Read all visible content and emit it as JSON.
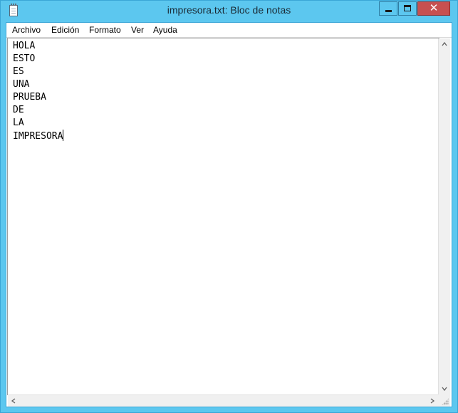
{
  "window": {
    "title": "impresora.txt: Bloc de notas",
    "close_glyph": "✕"
  },
  "menu": {
    "items": [
      "Archivo",
      "Edición",
      "Formato",
      "Ver",
      "Ayuda"
    ]
  },
  "editor": {
    "lines": [
      "HOLA",
      "ESTO",
      "ES",
      "UNA",
      "PRUEBA",
      "DE",
      "LA",
      "IMPRESORA"
    ]
  },
  "icons": {
    "app": "notepad-icon",
    "minimize": "minimize-icon",
    "maximize": "maximize-icon",
    "close": "close-icon"
  },
  "colors": {
    "titlebar": "#5cc7ef",
    "close_button": "#c75050"
  }
}
